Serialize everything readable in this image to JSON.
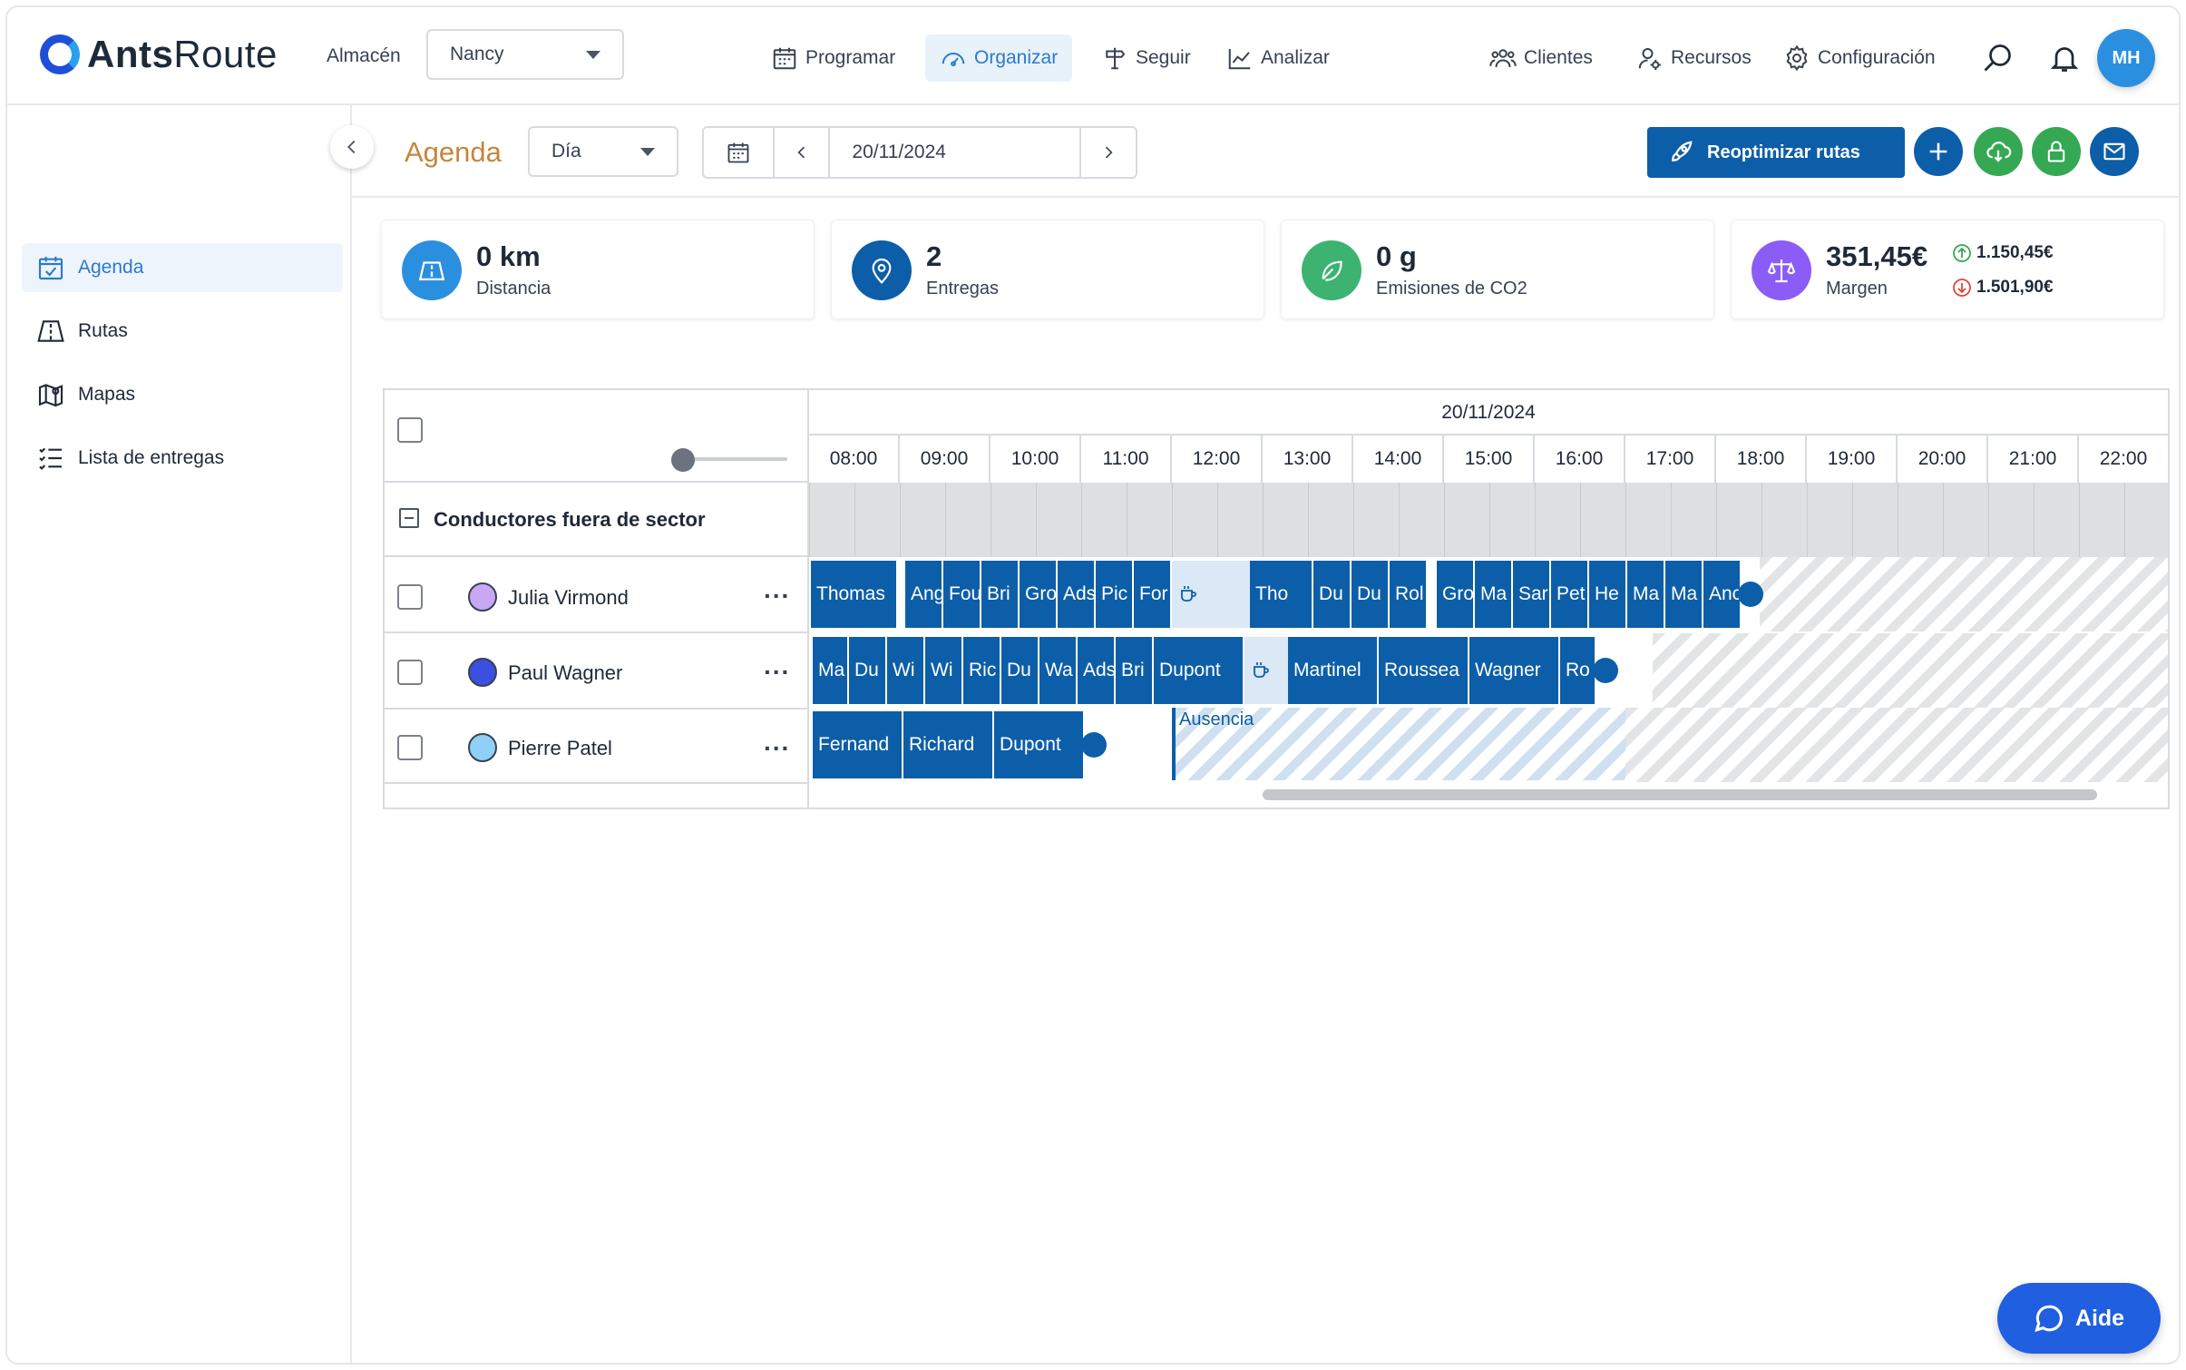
{
  "app": {
    "brand_bold": "Ants",
    "brand_light": "Route"
  },
  "header": {
    "warehouse_label": "Almacén",
    "warehouse_value": "Nancy",
    "nav": [
      {
        "label": "Programar",
        "icon": "calendar-icon"
      },
      {
        "label": "Organizar",
        "icon": "gauge-icon",
        "active": true
      },
      {
        "label": "Seguir",
        "icon": "signpost-icon"
      },
      {
        "label": "Analizar",
        "icon": "chart-icon"
      }
    ],
    "right_nav": [
      {
        "label": "Clientes",
        "icon": "users-icon"
      },
      {
        "label": "Recursos",
        "icon": "user-gear-icon"
      },
      {
        "label": "Configuración",
        "icon": "gear-icon"
      }
    ],
    "avatar_initials": "MH"
  },
  "sidebar": {
    "items": [
      {
        "label": "Agenda",
        "icon": "calendar-check-icon",
        "active": true
      },
      {
        "label": "Rutas",
        "icon": "road-icon"
      },
      {
        "label": "Mapas",
        "icon": "map-icon"
      },
      {
        "label": "Lista de entregas",
        "icon": "list-icon"
      }
    ]
  },
  "toolbar": {
    "title": "Agenda",
    "view_value": "Día",
    "date_value": "20/11/2024",
    "reoptimize_label": "Reoptimizar rutas",
    "colors": {
      "primary": "#0d5ea8",
      "green": "#34a853",
      "accent_title": "#c4863a"
    }
  },
  "kpis": [
    {
      "value": "0 km",
      "label": "Distancia",
      "icon": "road-icon",
      "color": "#2b8fe0"
    },
    {
      "value": "2",
      "label": "Entregas",
      "icon": "pin-icon",
      "color": "#0d5ea8"
    },
    {
      "value": "0 g",
      "label": "Emisiones de CO2",
      "icon": "leaf-icon",
      "color": "#3cb371"
    },
    {
      "value": "351,45€",
      "label": "Margen",
      "icon": "scale-icon",
      "color": "#8b5cf6",
      "up": "1.150,45€",
      "down": "1.501,90€"
    }
  ],
  "gantt": {
    "date": "20/11/2024",
    "hours": [
      "08:00",
      "09:00",
      "10:00",
      "11:00",
      "12:00",
      "13:00",
      "14:00",
      "15:00",
      "16:00",
      "17:00",
      "18:00",
      "19:00",
      "20:00",
      "21:00",
      "22:00"
    ],
    "group": "Conductores fuera de sector",
    "drivers": [
      {
        "name": "Julia Virmond",
        "color": "#c9a7f5"
      },
      {
        "name": "Paul Wagner",
        "color": "#3b4fe0"
      },
      {
        "name": "Pierre Patel",
        "color": "#8fd0f7"
      }
    ],
    "row_tasks": [
      [
        "Thomas",
        "Ang",
        "Fou",
        "Bri",
        "Gro",
        "Ads",
        "Pic",
        "For",
        "Tho",
        "Du",
        "Du",
        "Rol",
        "Gro",
        "Ma",
        "Sar",
        "Pet",
        "He",
        "Ma",
        "Ma",
        "Anc"
      ],
      [
        "Ma",
        "Du",
        "Wi",
        "Wi",
        "Ric",
        "Du",
        "Wa",
        "Ads",
        "Bri",
        "Dupont",
        "Martinel",
        "Roussea",
        "Wagner",
        "Ro"
      ],
      [
        "Fernand",
        "Richard",
        "Dupont"
      ]
    ],
    "absence_label": "Ausencia",
    "more_glyph": "..."
  },
  "help": {
    "label": "Aide"
  }
}
